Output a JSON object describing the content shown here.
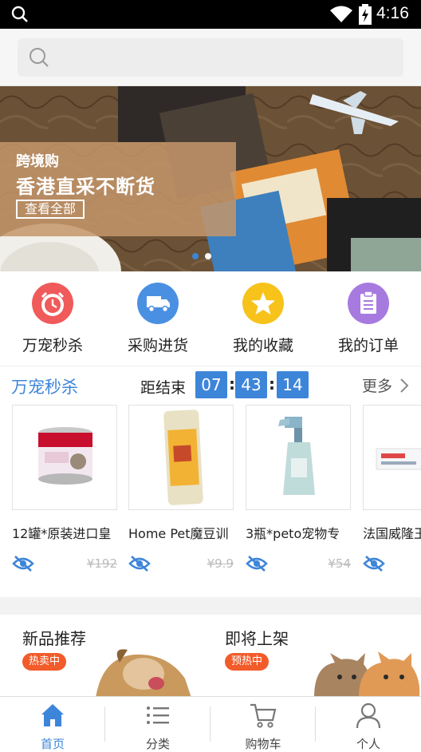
{
  "status_bar": {
    "time": "4:16"
  },
  "search": {
    "placeholder": ""
  },
  "banner": {
    "subtitle": "跨境购",
    "title": "香港直采不断货",
    "cta": "查看全部",
    "active_index": 0,
    "page_count": 2
  },
  "menu": [
    {
      "label": "万宠秒杀",
      "icon": "alarm-clock-icon",
      "color": "#f05a5a"
    },
    {
      "label": "采购进货",
      "icon": "truck-icon",
      "color": "#4a90e2"
    },
    {
      "label": "我的收藏",
      "icon": "star-icon",
      "color": "#f7c31b"
    },
    {
      "label": "我的订单",
      "icon": "clipboard-icon",
      "color": "#a77ae0"
    }
  ],
  "flash_sale": {
    "title": "万宠秒杀",
    "ends_label": "距结束",
    "hours": "07",
    "minutes": "43",
    "seconds": "14",
    "more": "更多",
    "products": [
      {
        "name": "12罐*原装进口皇",
        "price": "¥192"
      },
      {
        "name": "Home Pet魔豆训",
        "price": "¥9.9"
      },
      {
        "name": "3瓶*peto宠物专",
        "price": "¥54"
      },
      {
        "name": "法国威隆王",
        "price": ""
      }
    ]
  },
  "sections": [
    {
      "title": "新品推荐",
      "tag": "热卖中"
    },
    {
      "title": "即将上架",
      "tag": "预热中"
    }
  ],
  "tabs": [
    {
      "label": "首页",
      "icon": "home-icon",
      "active": true
    },
    {
      "label": "分类",
      "icon": "list-icon",
      "active": false
    },
    {
      "label": "购物车",
      "icon": "cart-icon",
      "active": false
    },
    {
      "label": "个人",
      "icon": "person-icon",
      "active": false
    }
  ],
  "colors": {
    "accent": "#3d85d9",
    "tag": "#f25b2a"
  }
}
